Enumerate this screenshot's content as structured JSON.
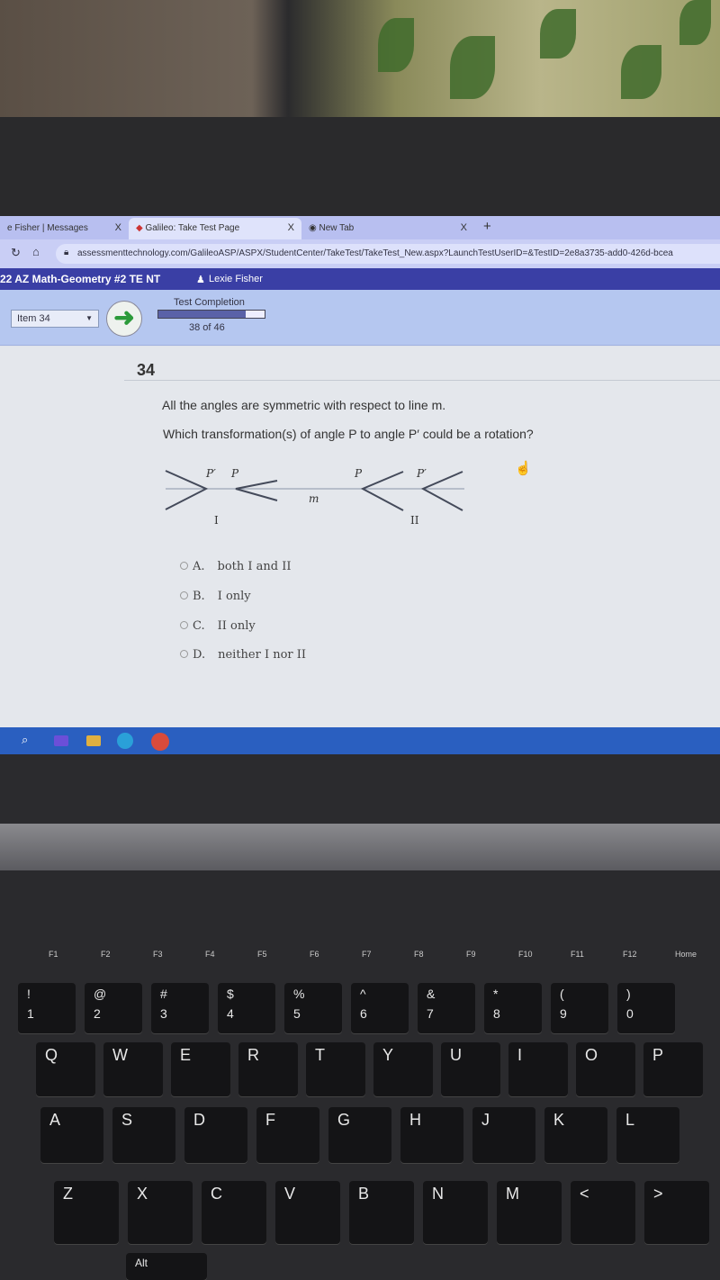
{
  "browser": {
    "tabs": [
      {
        "label": "e Fisher | Messages",
        "close": "X"
      },
      {
        "label": "Galileo: Take Test Page",
        "close": "X"
      },
      {
        "label": "New Tab",
        "close": "X"
      }
    ],
    "new_tab": "+",
    "url": "assessmenttechnology.com/GalileoASP/ASPX/StudentCenter/TakeTest/TakeTest_New.aspx?LaunchTestUserID=&TestID=2e8a3735-add0-426d-bcea"
  },
  "app": {
    "test_title": "22 AZ Math-Geometry #2 TE NT",
    "user": "Lexie Fisher",
    "item_select": "Item 34",
    "completion_label": "Test Completion",
    "completion_text": "38 of 46",
    "completion_fraction": 0.826
  },
  "question": {
    "number": "34",
    "line1": "All the angles are symmetric with respect to line m.",
    "line2": "Which transformation(s) of angle P to angle P′ could be a rotation?",
    "diagram": {
      "labels": {
        "p_prime": "P′",
        "p": "P",
        "line": "m",
        "fig1": "I",
        "fig2": "II"
      }
    },
    "options": [
      {
        "letter": "A.",
        "text": "both I and II"
      },
      {
        "letter": "B.",
        "text": "I only"
      },
      {
        "letter": "C.",
        "text": "II only"
      },
      {
        "letter": "D.",
        "text": "neither I nor II"
      }
    ]
  },
  "keyboard": {
    "fkeys": [
      "F1",
      "F2",
      "F3",
      "F4",
      "F5",
      "F6",
      "F7",
      "F8",
      "F9",
      "F10",
      "F11",
      "F12",
      "Home"
    ],
    "numbers": [
      [
        "!",
        "1"
      ],
      [
        "@",
        "2"
      ],
      [
        "#",
        "3"
      ],
      [
        "$",
        "4"
      ],
      [
        "%",
        "5"
      ],
      [
        "^",
        "6"
      ],
      [
        "&",
        "7"
      ],
      [
        "*",
        "8"
      ],
      [
        "(",
        "9"
      ],
      [
        ")",
        "0"
      ]
    ],
    "row1": [
      "Q",
      "W",
      "E",
      "R",
      "T",
      "Y",
      "U",
      "I",
      "O",
      "P"
    ],
    "row2": [
      "A",
      "S",
      "D",
      "F",
      "G",
      "H",
      "J",
      "K",
      "L"
    ],
    "row3": [
      "Z",
      "X",
      "C",
      "V",
      "B",
      "N",
      "M",
      "<",
      ">"
    ],
    "alt": "Alt"
  },
  "colors": {
    "title_bar": "#3a3fa5",
    "toolbar": "#b5c7f0",
    "taskbar": "#2a5fc0",
    "go_arrow": "#2b9a3a"
  }
}
